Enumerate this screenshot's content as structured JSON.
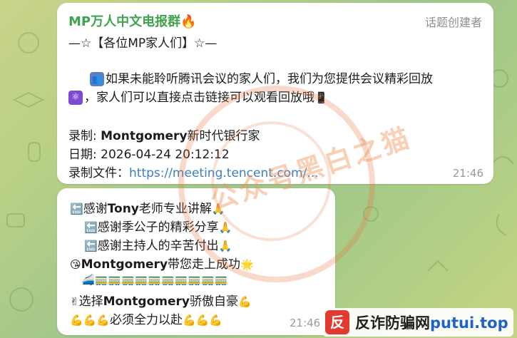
{
  "chat": {
    "message1": {
      "sender": "MP万人中文电报群🔥",
      "role": "话题创建者",
      "title": "—☆【各位MP家人们】☆—",
      "body_line1": "如果未能聆听腾讯会议的家人们，我们为您提供会议精彩回放",
      "body_line2": "，家人们可以直接点击链接可以观看回放哦",
      "record_label": "录制:",
      "record_value_bold": "Montgomery",
      "record_value_rest": "新时代银行家",
      "date_label": "日期:",
      "date_value": "2026-04-24 20:12:12",
      "file_label": "录制文件：",
      "file_link": "https://meeting.tencent.com/...",
      "time": "21:46"
    },
    "message2": {
      "line1_prefix": "感谢",
      "line1_bold": "Tony",
      "line1_rest": "老师专业讲解",
      "line2": "感谢季公子的精彩分享",
      "line3": "感谢主持人的辛苦付出",
      "line4_bold": "Montgomery",
      "line4_rest": "带您走上成功",
      "line6_prefix": "选择",
      "line6_bold": "Montgomery",
      "line6_rest": "骄傲自豪",
      "line7": "必须全力以赴",
      "time": "21:46"
    }
  },
  "watermark": {
    "seal_text": "公众号黑白之猫"
  },
  "badge": {
    "text_prefix": "反诈防骗网",
    "text_accent": "putui.top"
  },
  "icons": {
    "fire": "fire-icon",
    "phone": "mobile-phone-icon",
    "back_arrow": "end-arrow-icon",
    "pray": "folded-hands-icon",
    "star": "glowing-star-icon",
    "train": "train-icon",
    "muscle": "flexed-biceps-icon",
    "kiss": "kiss-face-icon",
    "victory": "victory-hand-icon"
  },
  "colors": {
    "sender": "#3fa34d",
    "link": "#3a7fc1",
    "time": "#9a9a9a",
    "badge_accent": "#1f63c9",
    "badge_logo": "#e23a2f"
  }
}
